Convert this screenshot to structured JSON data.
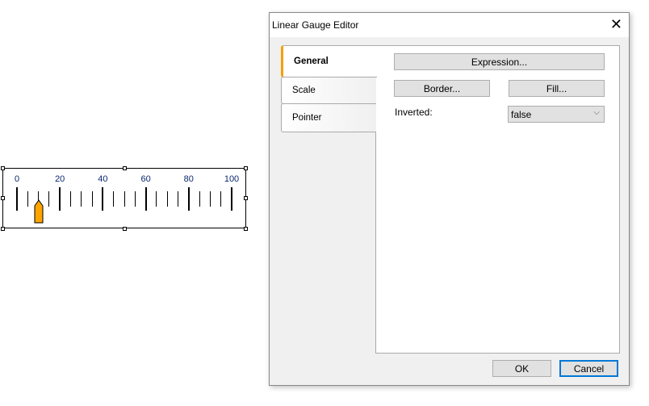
{
  "gauge": {
    "scale_labels": [
      "0",
      "20",
      "40",
      "60",
      "80",
      "100"
    ],
    "min": 0,
    "max": 100,
    "major_step": 20,
    "minor_step": 5,
    "pointer_value": 10,
    "pointer_color": "#ffa500"
  },
  "dialog": {
    "title": "Linear Gauge Editor",
    "close_icon": "close-icon",
    "tabs": [
      {
        "label": "General"
      },
      {
        "label": "Scale"
      },
      {
        "label": "Pointer"
      }
    ],
    "general": {
      "expression_button": "Expression...",
      "border_button": "Border...",
      "fill_button": "Fill...",
      "inverted_label": "Inverted:",
      "inverted_value": "false"
    },
    "ok_label": "OK",
    "cancel_label": "Cancel"
  }
}
